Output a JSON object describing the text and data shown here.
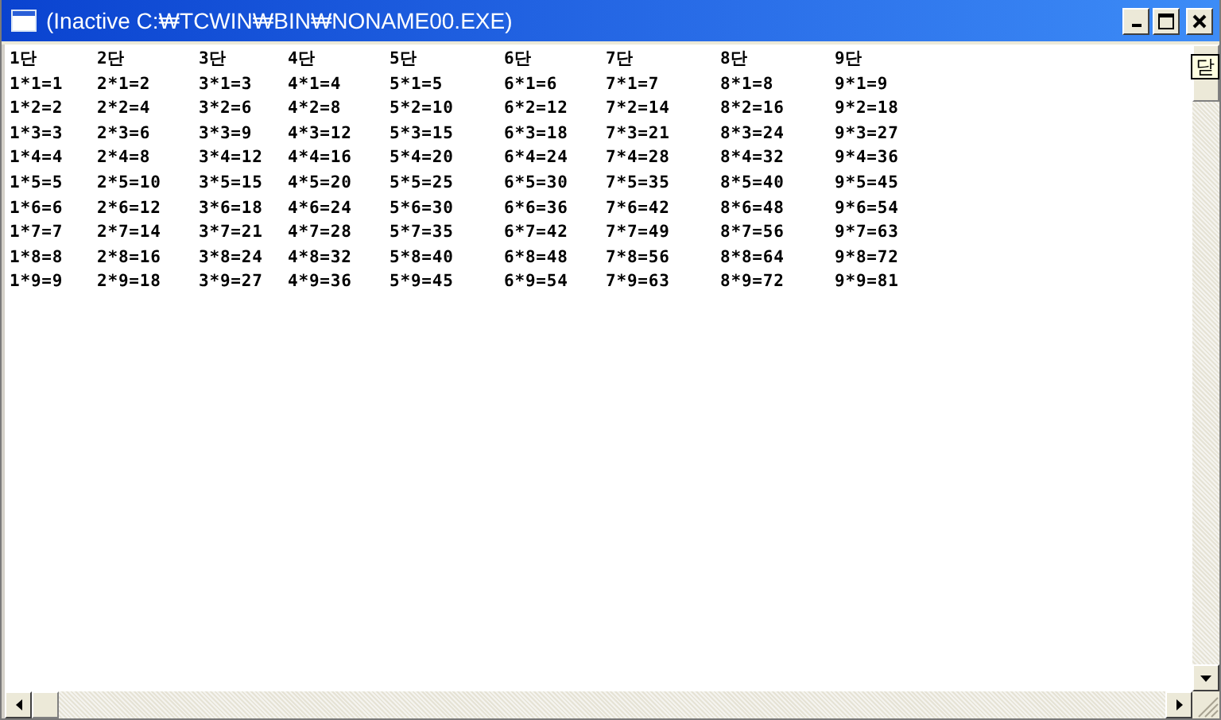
{
  "window": {
    "title": "(Inactive C:₩TCWIN₩BIN₩NONAME00.EXE)"
  },
  "tooltip": {
    "text": "닫"
  },
  "columns": [
    {
      "header": "1단",
      "rows": [
        "1*1=1",
        "1*2=2",
        "1*3=3",
        "1*4=4",
        "1*5=5",
        "1*6=6",
        "1*7=7",
        "1*8=8",
        "1*9=9"
      ]
    },
    {
      "header": "2단",
      "rows": [
        "2*1=2",
        "2*2=4",
        "2*3=6",
        "2*4=8",
        "2*5=10",
        "2*6=12",
        "2*7=14",
        "2*8=16",
        "2*9=18"
      ]
    },
    {
      "header": "3단",
      "rows": [
        "3*1=3",
        "3*2=6",
        "3*3=9",
        "3*4=12",
        "3*5=15",
        "3*6=18",
        "3*7=21",
        "3*8=24",
        "3*9=27"
      ]
    },
    {
      "header": "4단",
      "rows": [
        "4*1=4",
        "4*2=8",
        "4*3=12",
        "4*4=16",
        "4*5=20",
        "4*6=24",
        "4*7=28",
        "4*8=32",
        "4*9=36"
      ]
    },
    {
      "header": "5단",
      "rows": [
        "5*1=5",
        "5*2=10",
        "5*3=15",
        "5*4=20",
        "5*5=25",
        "5*6=30",
        "5*7=35",
        "5*8=40",
        "5*9=45"
      ]
    },
    {
      "header": "6단",
      "rows": [
        "6*1=6",
        "6*2=12",
        "6*3=18",
        "6*4=24",
        "6*5=30",
        "6*6=36",
        "6*7=42",
        "6*8=48",
        "6*9=54"
      ]
    },
    {
      "header": "7단",
      "rows": [
        "7*1=7",
        "7*2=14",
        "7*3=21",
        "7*4=28",
        "7*5=35",
        "7*6=42",
        "7*7=49",
        "7*8=56",
        "7*9=63"
      ]
    },
    {
      "header": "8단",
      "rows": [
        "8*1=8",
        "8*2=16",
        "8*3=24",
        "8*4=32",
        "8*5=40",
        "8*6=48",
        "8*7=56",
        "8*8=64",
        "8*9=72"
      ]
    },
    {
      "header": "9단",
      "rows": [
        "9*1=9",
        "9*2=18",
        "9*3=27",
        "9*4=36",
        "9*5=45",
        "9*6=54",
        "9*7=63",
        "9*8=72",
        "9*9=81"
      ]
    }
  ]
}
